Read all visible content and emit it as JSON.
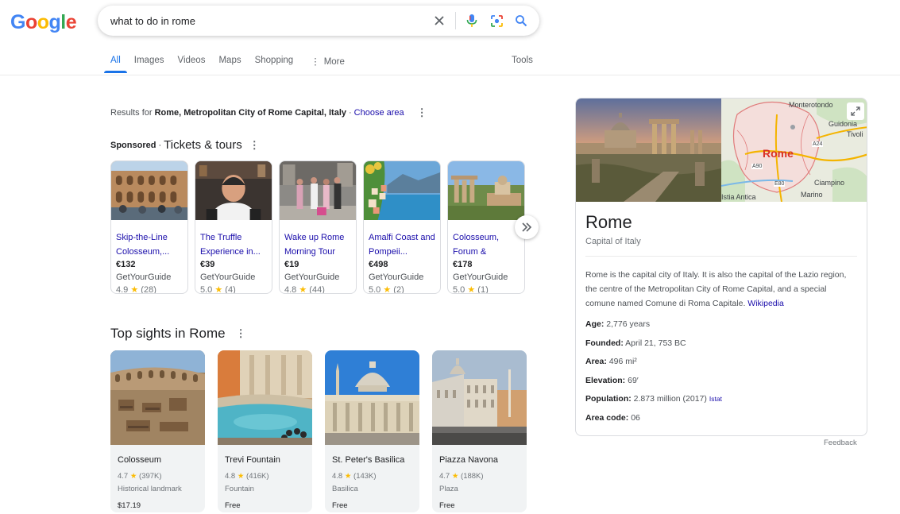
{
  "logo": {
    "letters": [
      "G",
      "o",
      "o",
      "g",
      "l",
      "e"
    ],
    "colors": [
      "#4285F4",
      "#EA4335",
      "#FBBC05",
      "#4285F4",
      "#34A853",
      "#EA4335"
    ]
  },
  "search": {
    "value": "what to do in rome",
    "icons": [
      "close-icon",
      "mic-icon",
      "lens-icon",
      "search-icon"
    ]
  },
  "nav": {
    "tabs": [
      {
        "label": "All",
        "active": true
      },
      {
        "label": "Images"
      },
      {
        "label": "Videos"
      },
      {
        "label": "Maps"
      },
      {
        "label": "Shopping"
      },
      {
        "label": "More"
      }
    ],
    "tools": "Tools"
  },
  "results_for": {
    "prefix": "Results for",
    "location": "Rome, Metropolitan City of Rome Capital, Italy",
    "sep": "·",
    "choose": "Choose area"
  },
  "sponsored": {
    "label": "Sponsored",
    "sep": "·",
    "title": "Tickets & tours",
    "cards": [
      {
        "title": "Skip-the-Line Colosseum,...",
        "price": "€132",
        "vendor": "GetYourGuide",
        "rating": "4.9",
        "count": "(28)"
      },
      {
        "title": "The Truffle Experience in...",
        "price": "€39",
        "vendor": "GetYourGuide",
        "rating": "5.0",
        "count": "(4)"
      },
      {
        "title": "Wake up Rome Morning Tour",
        "price": "€19",
        "vendor": "GetYourGuide",
        "rating": "4.8",
        "count": "(44)"
      },
      {
        "title": "Amalfi Coast and Pompeii...",
        "price": "€498",
        "vendor": "GetYourGuide",
        "rating": "5.0",
        "count": "(2)"
      },
      {
        "title": "Colosseum, Forum & Vatica...",
        "price": "€178",
        "vendor": "GetYourGuide",
        "rating": "5.0",
        "count": "(1)"
      }
    ]
  },
  "top_sights": {
    "title": "Top sights in Rome",
    "cards": [
      {
        "name": "Colosseum",
        "rating": "4.7",
        "count": "(397K)",
        "category": "Historical landmark",
        "price": "$17.19"
      },
      {
        "name": "Trevi Fountain",
        "rating": "4.8",
        "count": "(416K)",
        "category": "Fountain",
        "price": "Free"
      },
      {
        "name": "St. Peter's Basilica",
        "rating": "4.8",
        "count": "(143K)",
        "category": "Basilica",
        "price": "Free"
      },
      {
        "name": "Piazza Navona",
        "rating": "4.7",
        "count": "(188K)",
        "category": "Plaza",
        "price": "Free"
      }
    ]
  },
  "knowledge_panel": {
    "title": "Rome",
    "subtitle": "Capital of Italy",
    "description": "Rome is the capital city of Italy. It is also the capital of the Lazio region, the centre of the Metropolitan City of Rome Capital, and a special comune named Comune di Roma Capitale.",
    "wiki_link": "Wikipedia",
    "map_labels": [
      "Monterotondo",
      "Guidonia",
      "Tivoli",
      "Rome",
      "Ciampino",
      "Marino",
      "Istia Antica",
      "A24",
      "A90",
      "E80"
    ],
    "facts": [
      {
        "key": "Age:",
        "value": "2,776 years"
      },
      {
        "key": "Founded:",
        "value": "April 21, 753 BC"
      },
      {
        "key": "Area:",
        "value": "496 mi²"
      },
      {
        "key": "Elevation:",
        "value": "69′"
      },
      {
        "key": "Population:",
        "value": "2.873 million (2017)",
        "source": "Istat"
      },
      {
        "key": "Area code:",
        "value": "06"
      }
    ],
    "feedback": "Feedback"
  },
  "colors": {
    "link": "#1a0dab",
    "accent": "#1a73e8",
    "star": "#fbbc04",
    "road": "#e37400"
  }
}
